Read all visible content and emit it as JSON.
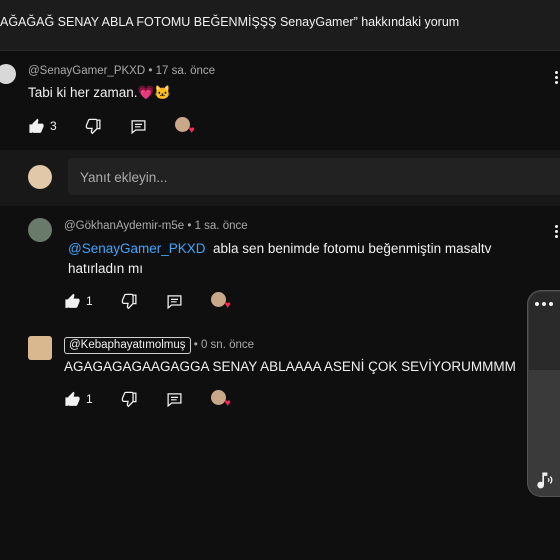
{
  "header": {
    "title": "AĞAĞAĞ SENAY ABLA FOTOMU BEĞENMİŞŞŞ SenayGamer” hakkındaki yorum"
  },
  "comment": {
    "handle": "@SenayGamer_PKXD",
    "time": "17 sa. önce",
    "text": "Tabi ki her zaman.💗🐱",
    "likes": "3"
  },
  "reply_box": {
    "placeholder": "Yanıt ekleyin..."
  },
  "replies": [
    {
      "handle": "@GökhanAydemir-m5e",
      "time": "1 sa. önce",
      "mention": "@SenayGamer_PKXD",
      "text": "abla sen benimde fotomu beğenmiştin masaltv hatırladın mı",
      "likes": "1"
    },
    {
      "handle": "@Kebaphayatımolmuş",
      "time": "0 sn. önce",
      "text": "AGAGAGAGAAGAGGA SENAY ABLAAAA ASENİ ÇOK SEVİYORUMMMM",
      "likes": "1"
    }
  ],
  "icons": {
    "like": "thumbs-up-icon",
    "dislike": "thumbs-down-icon",
    "reply": "reply-icon",
    "more": "more-vert-icon",
    "volume": "volume-icon",
    "heart": "creator-heart-icon"
  },
  "colors": {
    "background": "#0f0f0f",
    "mention": "#3ea6ff",
    "heart": "#ff2a55"
  }
}
